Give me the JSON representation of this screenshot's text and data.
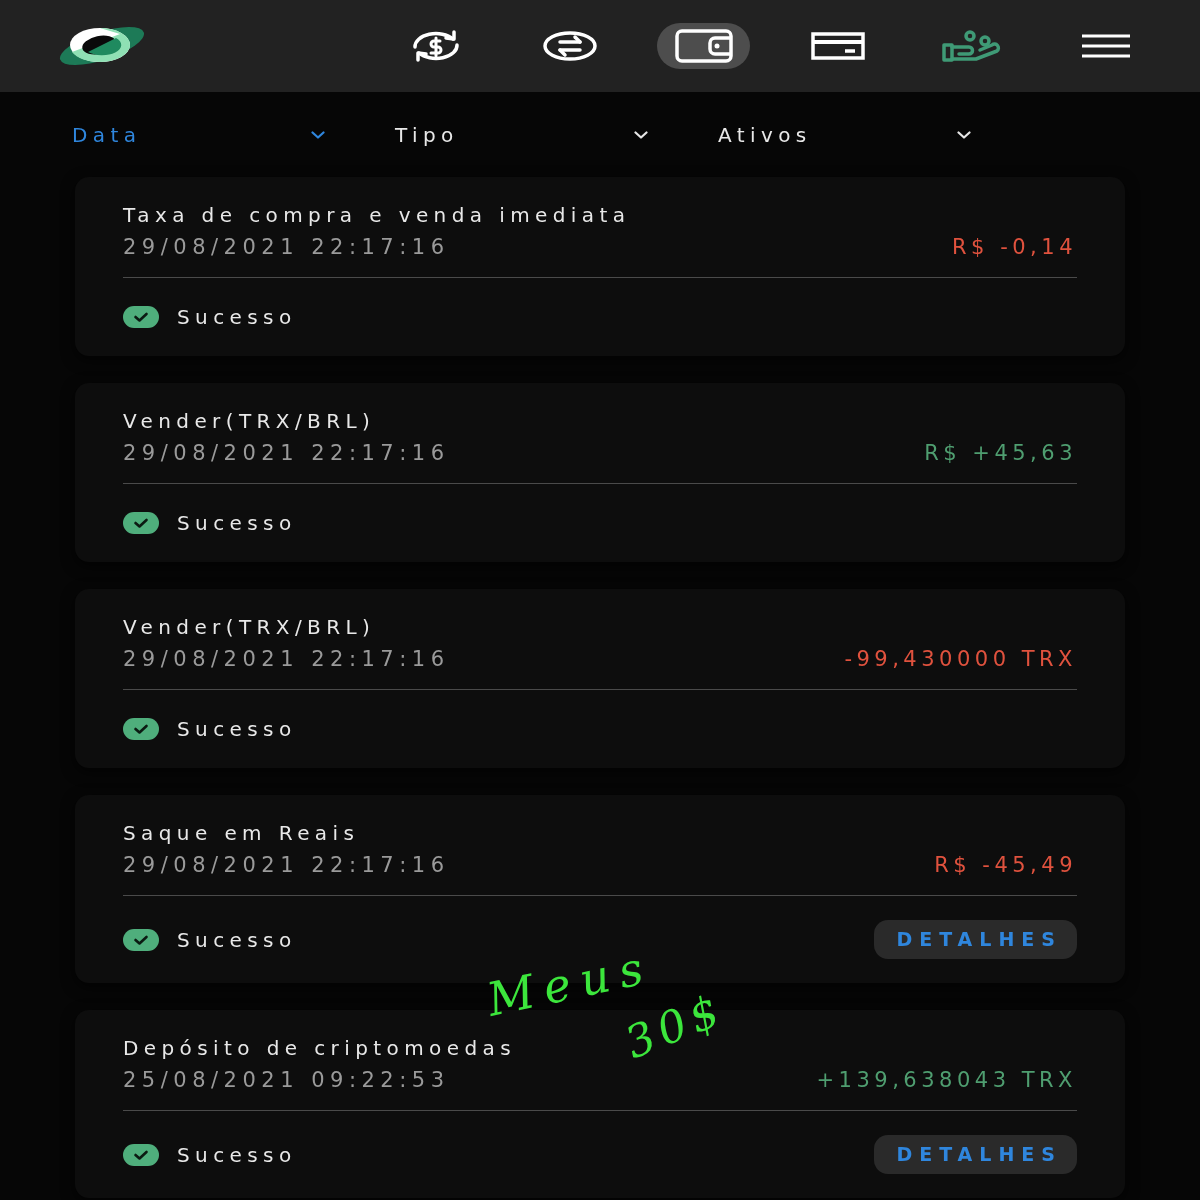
{
  "nav": {
    "items": [
      {
        "kind": "currency-exchange",
        "selected": false,
        "color": "#ffffff"
      },
      {
        "kind": "swap",
        "selected": false,
        "color": "#ffffff"
      },
      {
        "kind": "wallet",
        "selected": true,
        "color": "#ffffff"
      },
      {
        "kind": "card",
        "selected": false,
        "color": "#ffffff"
      },
      {
        "kind": "rewards",
        "selected": false,
        "color": "#3f9a76"
      },
      {
        "kind": "menu",
        "selected": false,
        "color": "#ffffff"
      }
    ]
  },
  "filters": [
    {
      "label": "Data",
      "selected": true
    },
    {
      "label": "Tipo",
      "selected": false
    },
    {
      "label": "Ativos",
      "selected": false
    }
  ],
  "transactions": [
    {
      "title": "Taxa de compra e venda imediata",
      "datetime": "29/08/2021 22:17:16",
      "amount": "R$ -0,14",
      "color": "#e0523e",
      "status": {
        "kind": "success",
        "label": "Sucesso"
      }
    },
    {
      "title": "Vender(TRX/BRL)",
      "datetime": "29/08/2021 22:17:16",
      "amount": "R$ +45,63",
      "color": "#4f9e70",
      "status": {
        "kind": "success",
        "label": "Sucesso"
      }
    },
    {
      "title": "Vender(TRX/BRL)",
      "datetime": "29/08/2021 22:17:16",
      "amount": "-99,430000 TRX",
      "color": "#e0523e",
      "status": {
        "kind": "success",
        "label": "Sucesso"
      }
    },
    {
      "title": "Saque em Reais",
      "datetime": "29/08/2021 22:17:16",
      "amount": "R$ -45,49",
      "color": "#e0523e",
      "status": {
        "kind": "success",
        "label": "Sucesso"
      },
      "action": "DETALHES"
    },
    {
      "title": "Depósito de criptomoedas",
      "datetime": "25/08/2021 09:22:53",
      "amount": "+139,638043 TRX",
      "color": "#4f9e70",
      "status": {
        "kind": "success",
        "label": "Sucesso"
      },
      "action": "DETALHES"
    }
  ],
  "handwritten_note": [
    "Meus",
    "30$"
  ]
}
